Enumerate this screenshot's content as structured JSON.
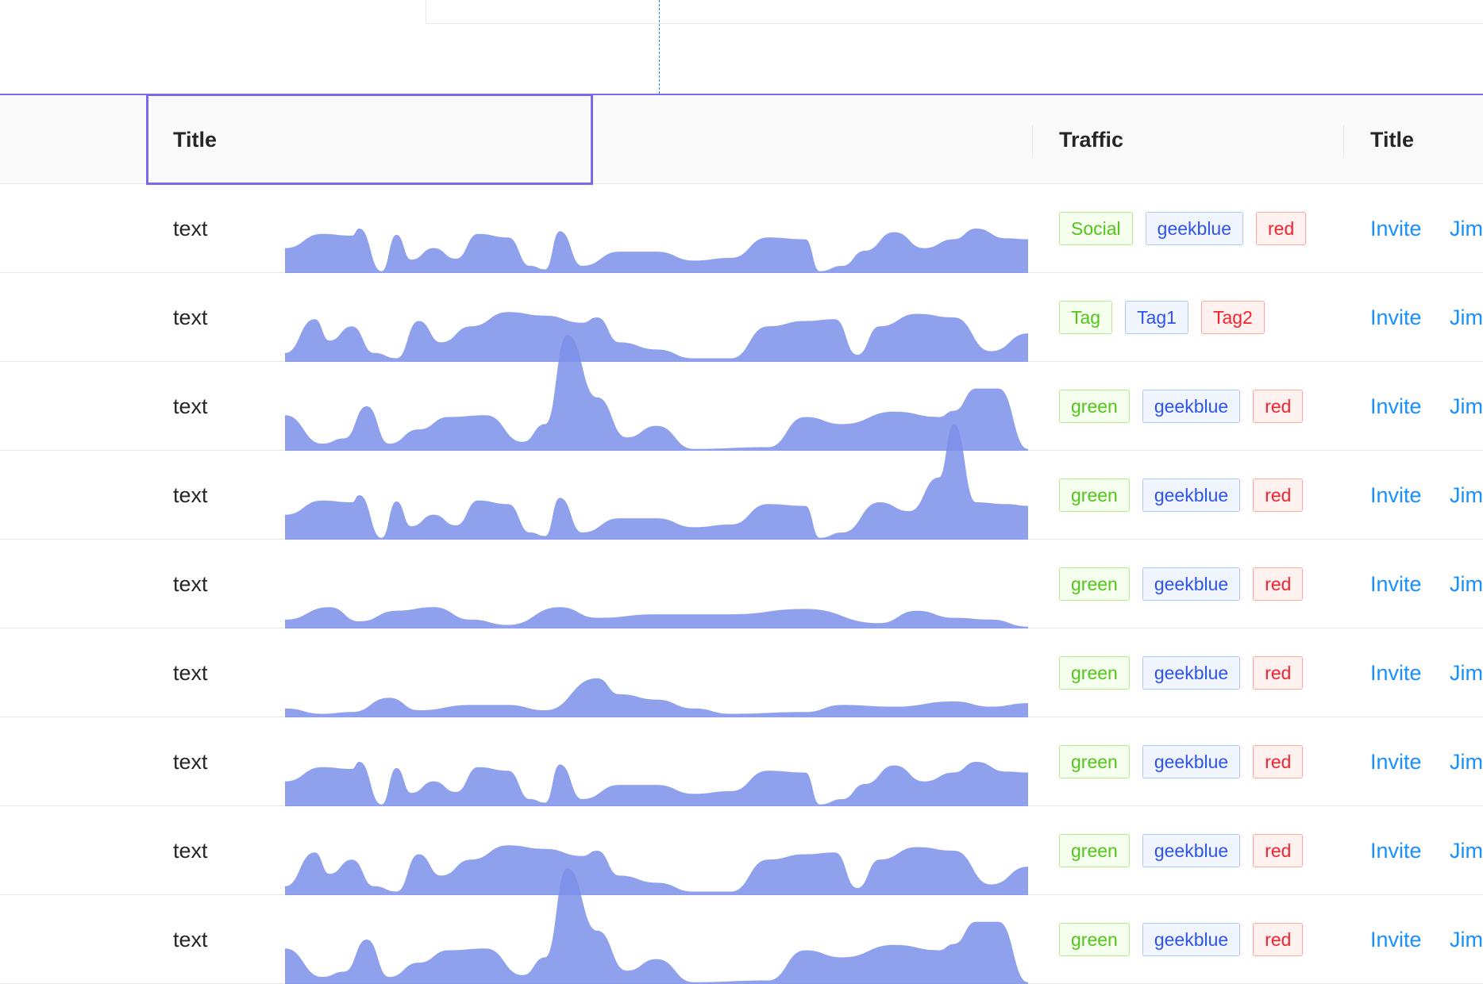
{
  "header": {
    "title_col": "Title",
    "traffic_col": "Traffic",
    "title_col2": "Title"
  },
  "colors": {
    "accent": "#7b68ee",
    "area_fill": "#7b8fe9",
    "link": "#1890ff"
  },
  "rows": [
    {
      "text": "text",
      "tags": [
        {
          "label": "Social",
          "color": "green"
        },
        {
          "label": "geekblue",
          "color": "geekblue"
        },
        {
          "label": "red",
          "color": "red"
        }
      ],
      "action": "Invite",
      "name": "Jim",
      "pattern": "A"
    },
    {
      "text": "text",
      "tags": [
        {
          "label": "Tag",
          "color": "green"
        },
        {
          "label": "Tag1",
          "color": "geekblue"
        },
        {
          "label": "Tag2",
          "color": "red"
        }
      ],
      "action": "Invite",
      "name": "Jim",
      "pattern": "B"
    },
    {
      "text": "text",
      "tags": [
        {
          "label": "green",
          "color": "green"
        },
        {
          "label": "geekblue",
          "color": "geekblue"
        },
        {
          "label": "red",
          "color": "red"
        }
      ],
      "action": "Invite",
      "name": "Jim",
      "pattern": "C"
    },
    {
      "text": "text",
      "tags": [
        {
          "label": "green",
          "color": "green"
        },
        {
          "label": "geekblue",
          "color": "geekblue"
        },
        {
          "label": "red",
          "color": "red"
        }
      ],
      "action": "Invite",
      "name": "Jim",
      "pattern": "D"
    },
    {
      "text": "text",
      "tags": [
        {
          "label": "green",
          "color": "green"
        },
        {
          "label": "geekblue",
          "color": "geekblue"
        },
        {
          "label": "red",
          "color": "red"
        }
      ],
      "action": "Invite",
      "name": "Jim",
      "pattern": "E"
    },
    {
      "text": "text",
      "tags": [
        {
          "label": "green",
          "color": "green"
        },
        {
          "label": "geekblue",
          "color": "geekblue"
        },
        {
          "label": "red",
          "color": "red"
        }
      ],
      "action": "Invite",
      "name": "Jim",
      "pattern": "F"
    },
    {
      "text": "text",
      "tags": [
        {
          "label": "green",
          "color": "green"
        },
        {
          "label": "geekblue",
          "color": "geekblue"
        },
        {
          "label": "red",
          "color": "red"
        }
      ],
      "action": "Invite",
      "name": "Jim",
      "pattern": "A"
    },
    {
      "text": "text",
      "tags": [
        {
          "label": "green",
          "color": "green"
        },
        {
          "label": "geekblue",
          "color": "geekblue"
        },
        {
          "label": "red",
          "color": "red"
        }
      ],
      "action": "Invite",
      "name": "Jim",
      "pattern": "B"
    },
    {
      "text": "text",
      "tags": [
        {
          "label": "green",
          "color": "green"
        },
        {
          "label": "geekblue",
          "color": "geekblue"
        },
        {
          "label": "red",
          "color": "red"
        }
      ],
      "action": "Invite",
      "name": "Jim",
      "pattern": "C"
    }
  ]
}
